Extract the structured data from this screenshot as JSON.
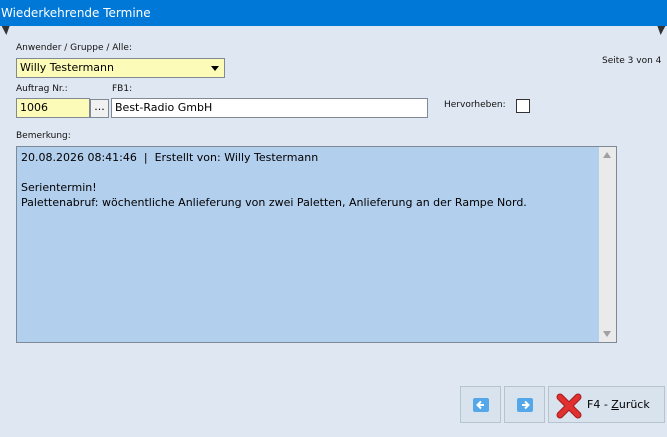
{
  "window": {
    "title": "Wiederkehrende Termine"
  },
  "page_indicator": "Seite 3 von 4",
  "user_group": {
    "label": "Anwender / Gruppe / Alle:",
    "value": "Willy Testermann"
  },
  "order": {
    "label": "Auftrag Nr.:",
    "value": "1006",
    "lookup_label": "..."
  },
  "fb1": {
    "label": "FB1:",
    "value": "Best-Radio GmbH"
  },
  "highlight": {
    "label": "Hervorheben:",
    "checked": false
  },
  "remark": {
    "label": "Bemerkung:",
    "text": "20.08.2026 08:41:46  |  Erstellt von: Willy Testermann\n\nSerientermin!\nPalettenabruf: wöchentliche Anlieferung von zwei Paletten, Anlieferung an der Rampe Nord."
  },
  "buttons": {
    "prev_icon": "arrow-left-icon",
    "next_icon": "arrow-right-icon",
    "back_icon": "red-x-icon",
    "back_prefix": "F4 - ",
    "back_underlined": "Z",
    "back_rest": "urück"
  },
  "colors": {
    "titlebar": "#0078d7",
    "background": "#dfe8f2",
    "yellow_field": "#fdfbb8",
    "memo": "#b3cfee",
    "close_red": "#e03030"
  }
}
